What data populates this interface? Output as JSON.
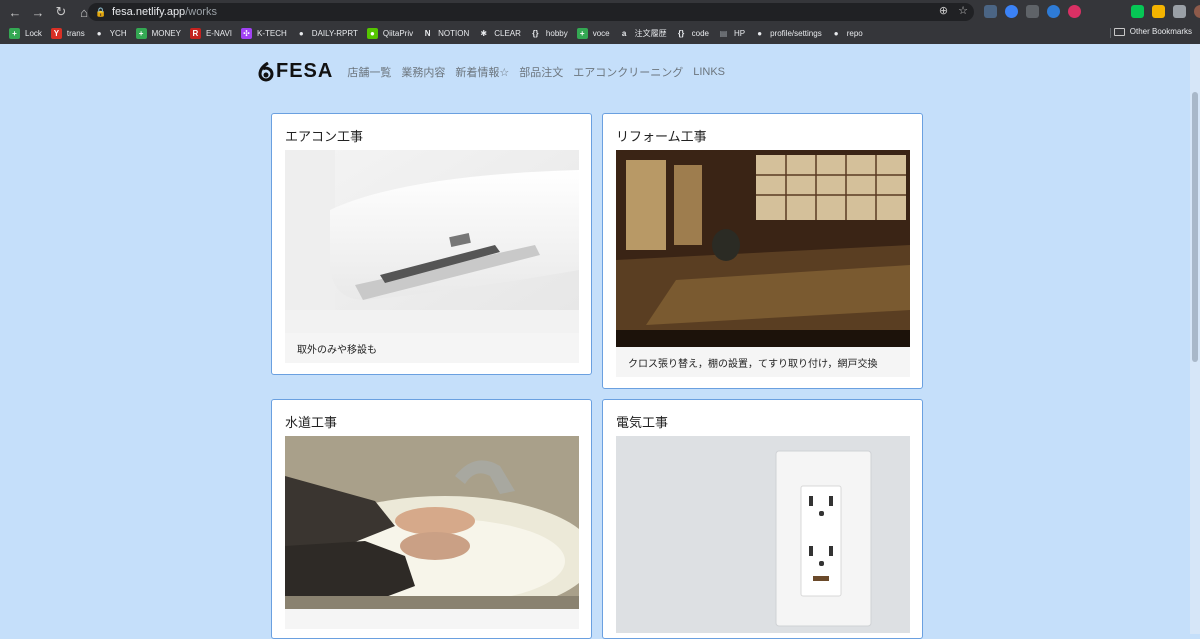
{
  "browser": {
    "url_host": "fesa.netlify.app",
    "url_path": "/works",
    "bookmarks": [
      {
        "label": "Lock",
        "icon": "plus-green-icon",
        "color": "#34a853"
      },
      {
        "label": "trans",
        "icon": "y-red-icon",
        "color": "#d93025"
      },
      {
        "label": "YCH",
        "icon": "globe-icon",
        "color": "#e8eaed"
      },
      {
        "label": "MONEY",
        "icon": "plus-green-icon",
        "color": "#34a853"
      },
      {
        "label": "E-NAVI",
        "icon": "r-red-icon",
        "color": "#c5221f"
      },
      {
        "label": "K-TECH",
        "icon": "purple-dots-icon",
        "color": "#a142f4"
      },
      {
        "label": "DAILY-RPRT",
        "icon": "github-icon",
        "color": "#e8eaed"
      },
      {
        "label": "QiitaPriv",
        "icon": "qiita-icon",
        "color": "#55c500"
      },
      {
        "label": "NOTION",
        "icon": "notion-icon",
        "color": "#e8eaed"
      },
      {
        "label": "CLEAR",
        "icon": "gear-icon",
        "color": "#e8eaed"
      },
      {
        "label": "hobby",
        "icon": "braces-icon",
        "color": "#e8eaed"
      },
      {
        "label": "voce",
        "icon": "plus-green-icon",
        "color": "#34a853"
      },
      {
        "label": "注文履歴",
        "icon": "amazon-icon",
        "color": "#e8eaed"
      },
      {
        "label": "code",
        "icon": "braces-icon",
        "color": "#e8eaed"
      },
      {
        "label": "HP",
        "icon": "page-icon",
        "color": "#9aa0a6"
      },
      {
        "label": "profile/settings",
        "icon": "github-icon",
        "color": "#e8eaed"
      },
      {
        "label": "repo",
        "icon": "github-icon",
        "color": "#e8eaed"
      }
    ],
    "other_bookmarks": "Other Bookmarks"
  },
  "site": {
    "logo": "FESA",
    "nav": [
      "店舗一覧",
      "業務内容",
      "新着情報☆",
      "部品注文",
      "エアコンクリーニング",
      "LINKS"
    ]
  },
  "cards": [
    {
      "title": "エアコン工事",
      "caption": "取外のみや移設も",
      "image": "air-conditioner-photo"
    },
    {
      "title": "リフォーム工事",
      "caption": "クロス張り替え，棚の設置，てすり取り付け，網戸交換",
      "image": "japanese-room-photo"
    },
    {
      "title": "水道工事",
      "caption": "",
      "image": "hand-washing-photo"
    },
    {
      "title": "電気工事",
      "caption": "",
      "image": "electrical-outlet-photo"
    }
  ]
}
